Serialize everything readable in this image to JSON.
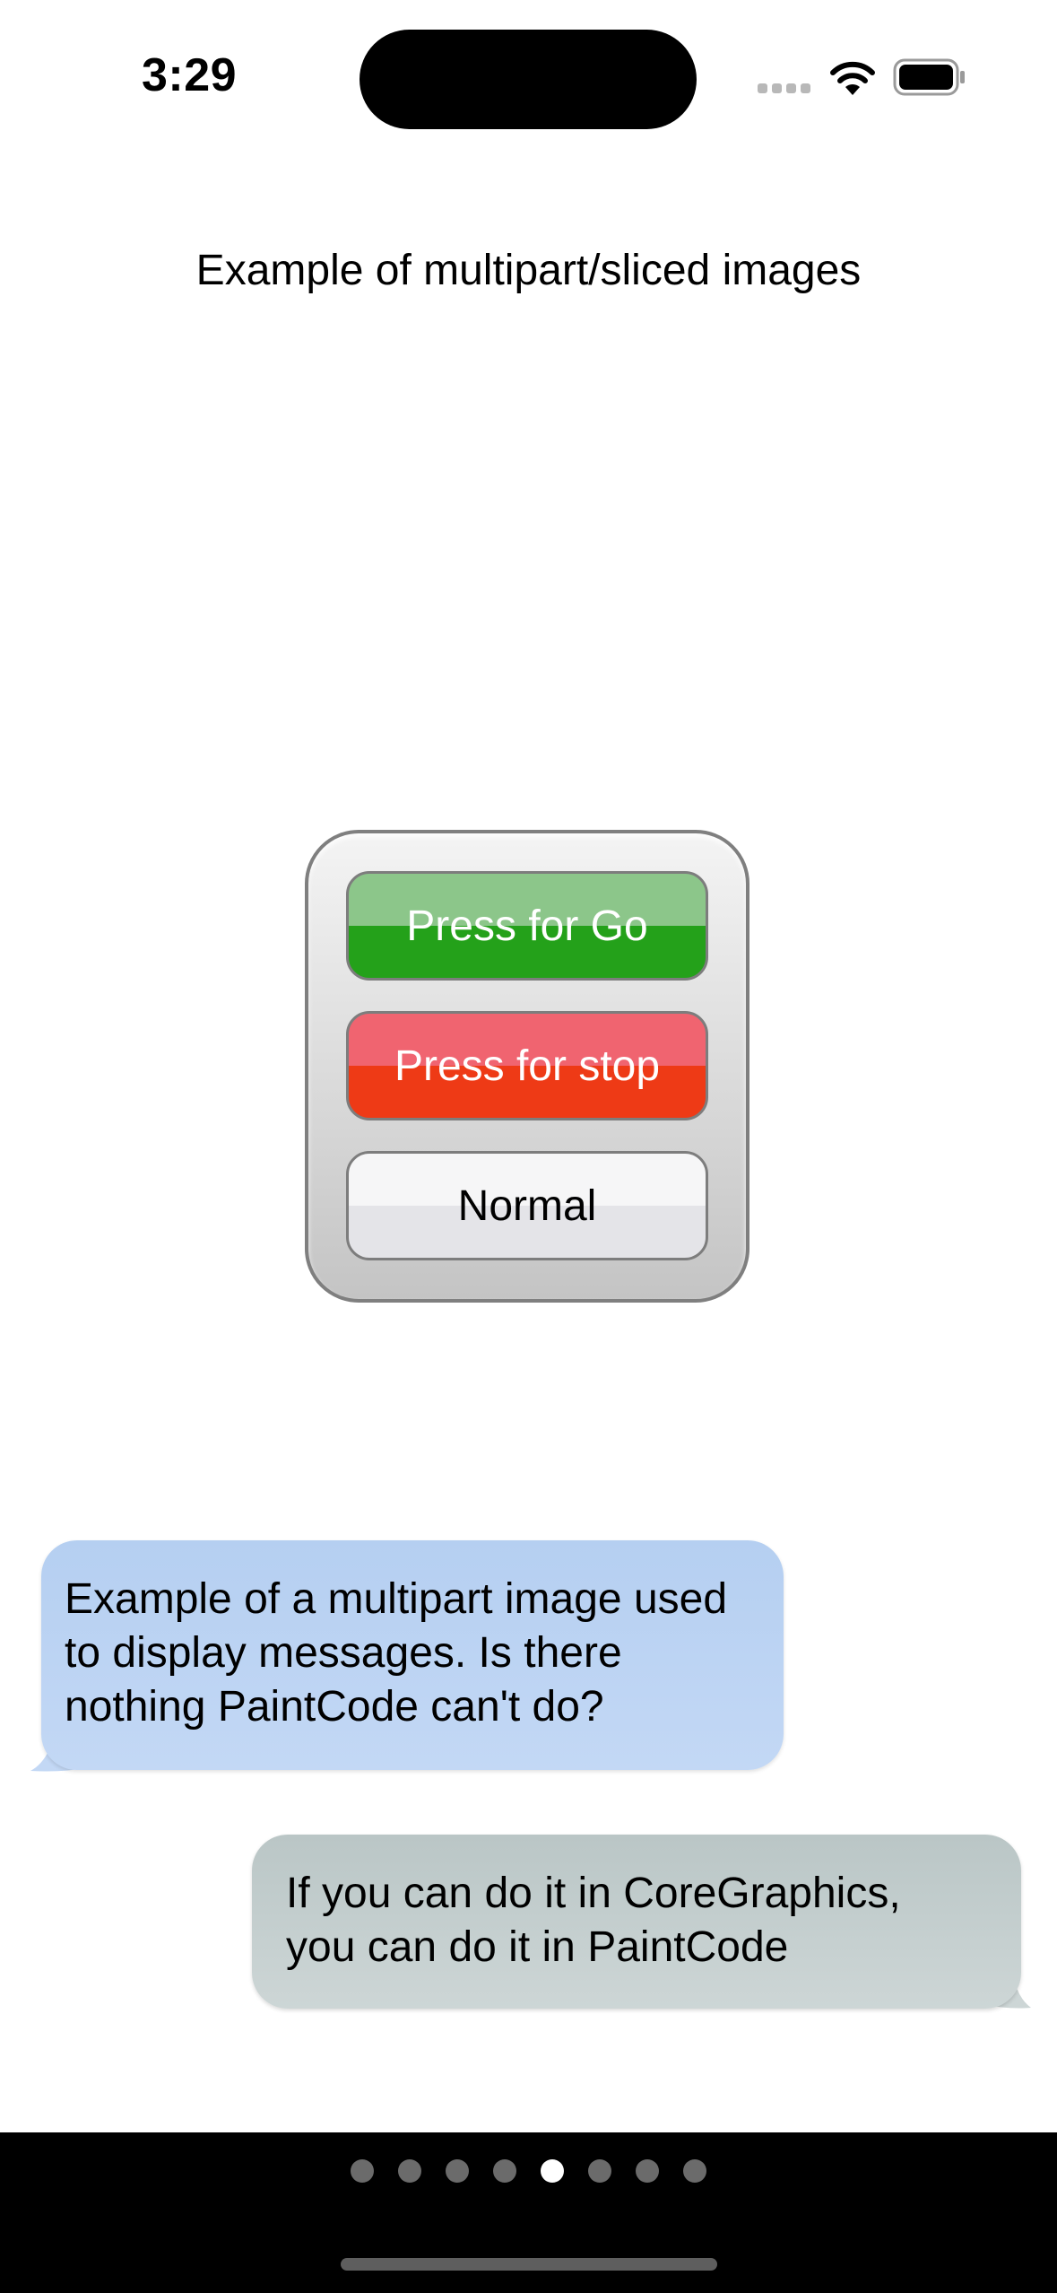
{
  "status_bar": {
    "time": "3:29"
  },
  "page": {
    "title": "Example of multipart/sliced images"
  },
  "buttons": {
    "go_label": "Press for Go",
    "stop_label": "Press for stop",
    "normal_label": "Normal"
  },
  "messages": {
    "incoming": {
      "lines": [
        "Example of a multipart image used",
        "to display messages.  Is there",
        "nothing PaintCode can't do?"
      ]
    },
    "outgoing": {
      "lines": [
        "If you can do it in CoreGraphics,",
        "you can do it in PaintCode"
      ]
    }
  },
  "pager": {
    "page_count": 8,
    "current_page": 5
  },
  "colors": {
    "go_top": "#8cc68a",
    "go_bottom": "#24a11a",
    "stop_top": "#f06470",
    "stop_bottom": "#ee3a16",
    "incoming_bubble": "#b5cff1",
    "outgoing_bubble": "#bac6c6"
  },
  "icons": {
    "signal": "cellular-signal-icon",
    "wifi": "wifi-icon",
    "battery": "battery-icon"
  }
}
